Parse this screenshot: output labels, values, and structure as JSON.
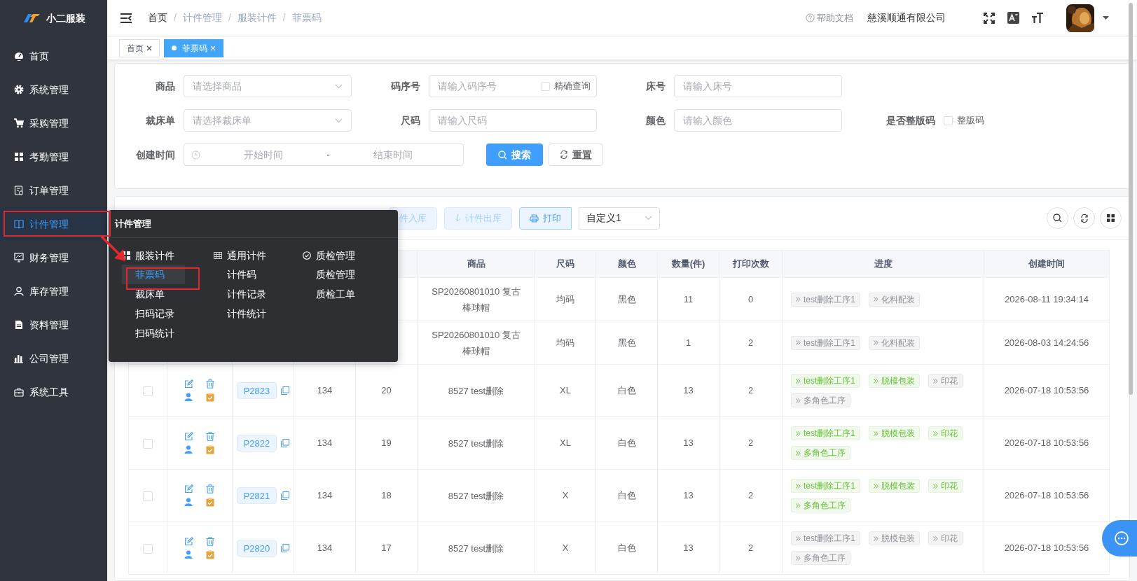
{
  "brand": "小二服装",
  "sidebar": {
    "items": [
      {
        "label": "首页",
        "selected": false
      },
      {
        "label": "系统管理",
        "selected": false
      },
      {
        "label": "采购管理",
        "selected": false
      },
      {
        "label": "考勤管理",
        "selected": false
      },
      {
        "label": "订单管理",
        "selected": false
      },
      {
        "label": "计件管理",
        "selected": true
      },
      {
        "label": "财务管理",
        "selected": false
      },
      {
        "label": "库存管理",
        "selected": false
      },
      {
        "label": "资料管理",
        "selected": false
      },
      {
        "label": "公司管理",
        "selected": false
      },
      {
        "label": "系统工具",
        "selected": false
      }
    ]
  },
  "breadcrumb": [
    "首页",
    "计件管理",
    "服装计件",
    "菲票码"
  ],
  "breadcrumb_separator": "/",
  "header": {
    "help": "帮助文档",
    "company": "慈溪顺通有限公司"
  },
  "tabs": [
    {
      "label": "首页",
      "selected": false
    },
    {
      "label": "菲票码",
      "selected": true
    }
  ],
  "submenu": {
    "title": "计件管理",
    "groups": [
      {
        "title": "服装计件",
        "items": [
          {
            "label": "菲票码",
            "selected": true
          },
          {
            "label": "裁床单",
            "selected": false
          },
          {
            "label": "扫码记录",
            "selected": false
          },
          {
            "label": "扫码统计",
            "selected": false
          }
        ]
      },
      {
        "title": "通用计件",
        "items": [
          {
            "label": "计件码",
            "selected": false
          },
          {
            "label": "计件记录",
            "selected": false
          },
          {
            "label": "计件统计",
            "selected": false
          }
        ]
      },
      {
        "title": "质检管理",
        "items": [
          {
            "label": "质检管理",
            "selected": false
          },
          {
            "label": "质检工单",
            "selected": false
          }
        ]
      }
    ]
  },
  "search": {
    "rows": [
      [
        {
          "kind": "select",
          "label": "商品",
          "placeholder": "请选择商品"
        },
        {
          "kind": "input",
          "label": "码序号",
          "placeholder": "请输入码序号",
          "checkbox": {
            "label": "精确查询",
            "checked": false
          }
        },
        {
          "kind": "input",
          "label": "床号",
          "placeholder": "请输入床号"
        }
      ],
      [
        {
          "kind": "select",
          "label": "裁床单",
          "placeholder": "请选择裁床单"
        },
        {
          "kind": "input",
          "label": "尺码",
          "placeholder": "请输入尺码"
        },
        {
          "kind": "input",
          "label": "颜色",
          "placeholder": "请输入颜色"
        },
        {
          "kind": "check",
          "label": "是否整版码",
          "checkbox": {
            "label": "整版码",
            "checked": false
          }
        }
      ],
      [
        {
          "kind": "daterange",
          "label": "创建时间",
          "start": "开始时间",
          "sep": "-",
          "end": "结束时间"
        }
      ]
    ],
    "buttons": [
      {
        "kind": "primary",
        "label": "搜索"
      },
      {
        "kind": "plain",
        "label": "重置"
      }
    ]
  },
  "toolbar": {
    "buttons": [
      {
        "kind": "light",
        "label": "件入库",
        "disabled": true
      },
      {
        "kind": "down",
        "label": "计件出库",
        "disabled": true
      },
      {
        "kind": "print",
        "label": "打印",
        "disabled": false
      }
    ],
    "template": "自定义1"
  },
  "table": {
    "columns": [
      "商品",
      "尺码",
      "颜色",
      "数量(件)",
      "打印次数",
      "进度",
      "创建时间"
    ],
    "rows": [
      {
        "product": "SP20260801010 复古棒球帽",
        "size": "均码",
        "color_name": "黑色",
        "qty": "11",
        "prints": "0",
        "progress": [
          {
            "label": "test删除工序1",
            "done": false
          },
          {
            "label": "化料配装",
            "done": false
          }
        ],
        "created": "2026-08-11 19:34:14"
      },
      {
        "product": "SP20260801010 复古棒球帽",
        "size": "均码",
        "color_name": "黑色",
        "qty": "1",
        "prints": "2",
        "progress": [
          {
            "label": "test删除工序1",
            "done": false
          },
          {
            "label": "化料配装",
            "done": false
          }
        ],
        "created": "2026-08-03 14:24:56"
      },
      {
        "checked": false,
        "code": "P2823",
        "bed": "134",
        "seq": "20",
        "product": "8527 test删除",
        "size": "XL",
        "color_name": "白色",
        "qty": "13",
        "prints": "2",
        "progress": [
          {
            "label": "test删除工序1",
            "done": true
          },
          {
            "label": "脱模包装",
            "done": true
          },
          {
            "label": "印花",
            "done": false
          },
          {
            "label": "多角色工序",
            "done": false
          }
        ],
        "created": "2026-07-18 10:53:56"
      },
      {
        "checked": false,
        "code": "P2822",
        "bed": "134",
        "seq": "19",
        "product": "8527 test删除",
        "size": "XL",
        "color_name": "白色",
        "qty": "13",
        "prints": "2",
        "progress": [
          {
            "label": "test删除工序1",
            "done": true
          },
          {
            "label": "脱模包装",
            "done": true
          },
          {
            "label": "印花",
            "done": true
          },
          {
            "label": "多角色工序",
            "done": true
          }
        ],
        "created": "2026-07-18 10:53:56"
      },
      {
        "checked": false,
        "code": "P2821",
        "bed": "134",
        "seq": "18",
        "product": "8527 test删除",
        "size": "X",
        "color_name": "白色",
        "qty": "13",
        "prints": "2",
        "progress": [
          {
            "label": "test删除工序1",
            "done": true
          },
          {
            "label": "脱模包装",
            "done": true
          },
          {
            "label": "印花",
            "done": true
          },
          {
            "label": "多角色工序",
            "done": true
          }
        ],
        "created": "2026-07-18 10:53:56"
      },
      {
        "checked": false,
        "code": "P2820",
        "bed": "134",
        "seq": "17",
        "product": "8527 test删除",
        "size": "X",
        "color_name": "白色",
        "qty": "13",
        "prints": "2",
        "progress": [
          {
            "label": "test删除工序1",
            "done": false
          },
          {
            "label": "脱模包装",
            "done": false
          },
          {
            "label": "印花",
            "done": false
          },
          {
            "label": "多角色工序",
            "done": false
          }
        ],
        "created": "2026-07-18 10:53:56"
      }
    ]
  }
}
